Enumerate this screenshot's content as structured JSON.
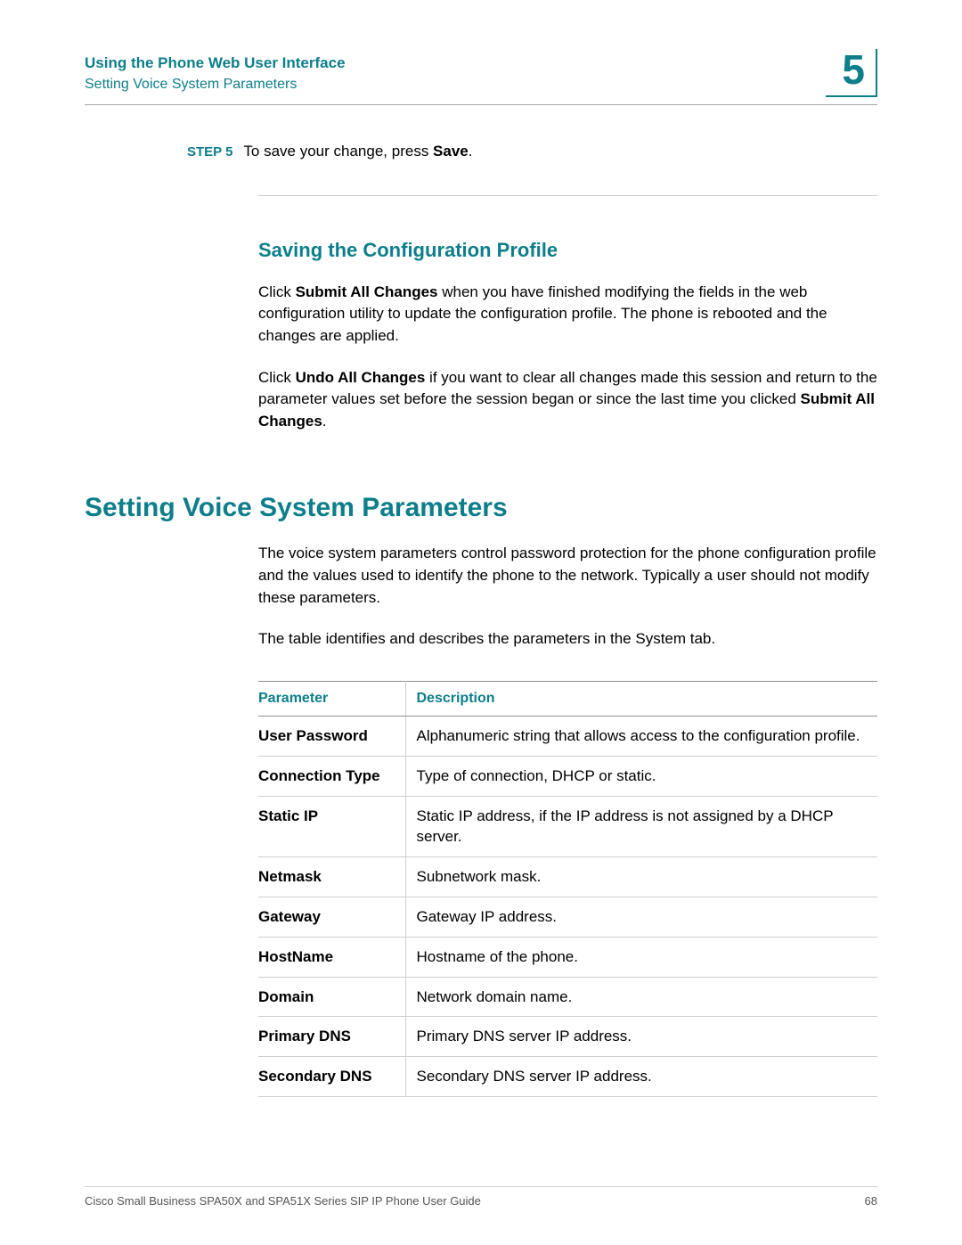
{
  "header": {
    "title": "Using the Phone Web User Interface",
    "subtitle": "Setting Voice System Parameters",
    "chapter": "5"
  },
  "step": {
    "label": "STEP 5",
    "text_before": "To save your change, press ",
    "text_bold": "Save",
    "text_after": "."
  },
  "section1": {
    "heading": "Saving the Configuration Profile",
    "p1_a": "Click ",
    "p1_b": "Submit All Changes",
    "p1_c": " when you have finished modifying the fields in the web configuration utility to update the configuration profile. The phone is rebooted and the changes are applied.",
    "p2_a": "Click ",
    "p2_b": "Undo All Changes",
    "p2_c": " if you want to clear all changes made this session and return to the parameter values set before the session began or since the last time you clicked ",
    "p2_d": "Submit All Changes",
    "p2_e": "."
  },
  "section2": {
    "heading": "Setting Voice System Parameters",
    "p1": "The voice system parameters control password protection for the phone configuration profile and the values used to identify the phone to the network. Typically a user should not modify these parameters.",
    "p2": "The table identifies and describes the parameters in the System tab."
  },
  "table": {
    "col1": "Parameter",
    "col2": "Description",
    "rows": [
      {
        "p": "User Password",
        "d": "Alphanumeric string that allows access to the configuration profile."
      },
      {
        "p": "Connection Type",
        "d": "Type of connection, DHCP or static."
      },
      {
        "p": "Static IP",
        "d": "Static IP address, if the IP address is not assigned by a DHCP server."
      },
      {
        "p": "Netmask",
        "d": "Subnetwork mask."
      },
      {
        "p": "Gateway",
        "d": "Gateway IP address."
      },
      {
        "p": "HostName",
        "d": "Hostname of the phone."
      },
      {
        "p": "Domain",
        "d": "Network domain name."
      },
      {
        "p": "Primary DNS",
        "d": "Primary DNS server IP address."
      },
      {
        "p": "Secondary DNS",
        "d": "Secondary DNS server IP address."
      }
    ]
  },
  "footer": {
    "doc": "Cisco Small Business SPA50X and SPA51X Series SIP IP Phone User Guide",
    "page": "68"
  }
}
